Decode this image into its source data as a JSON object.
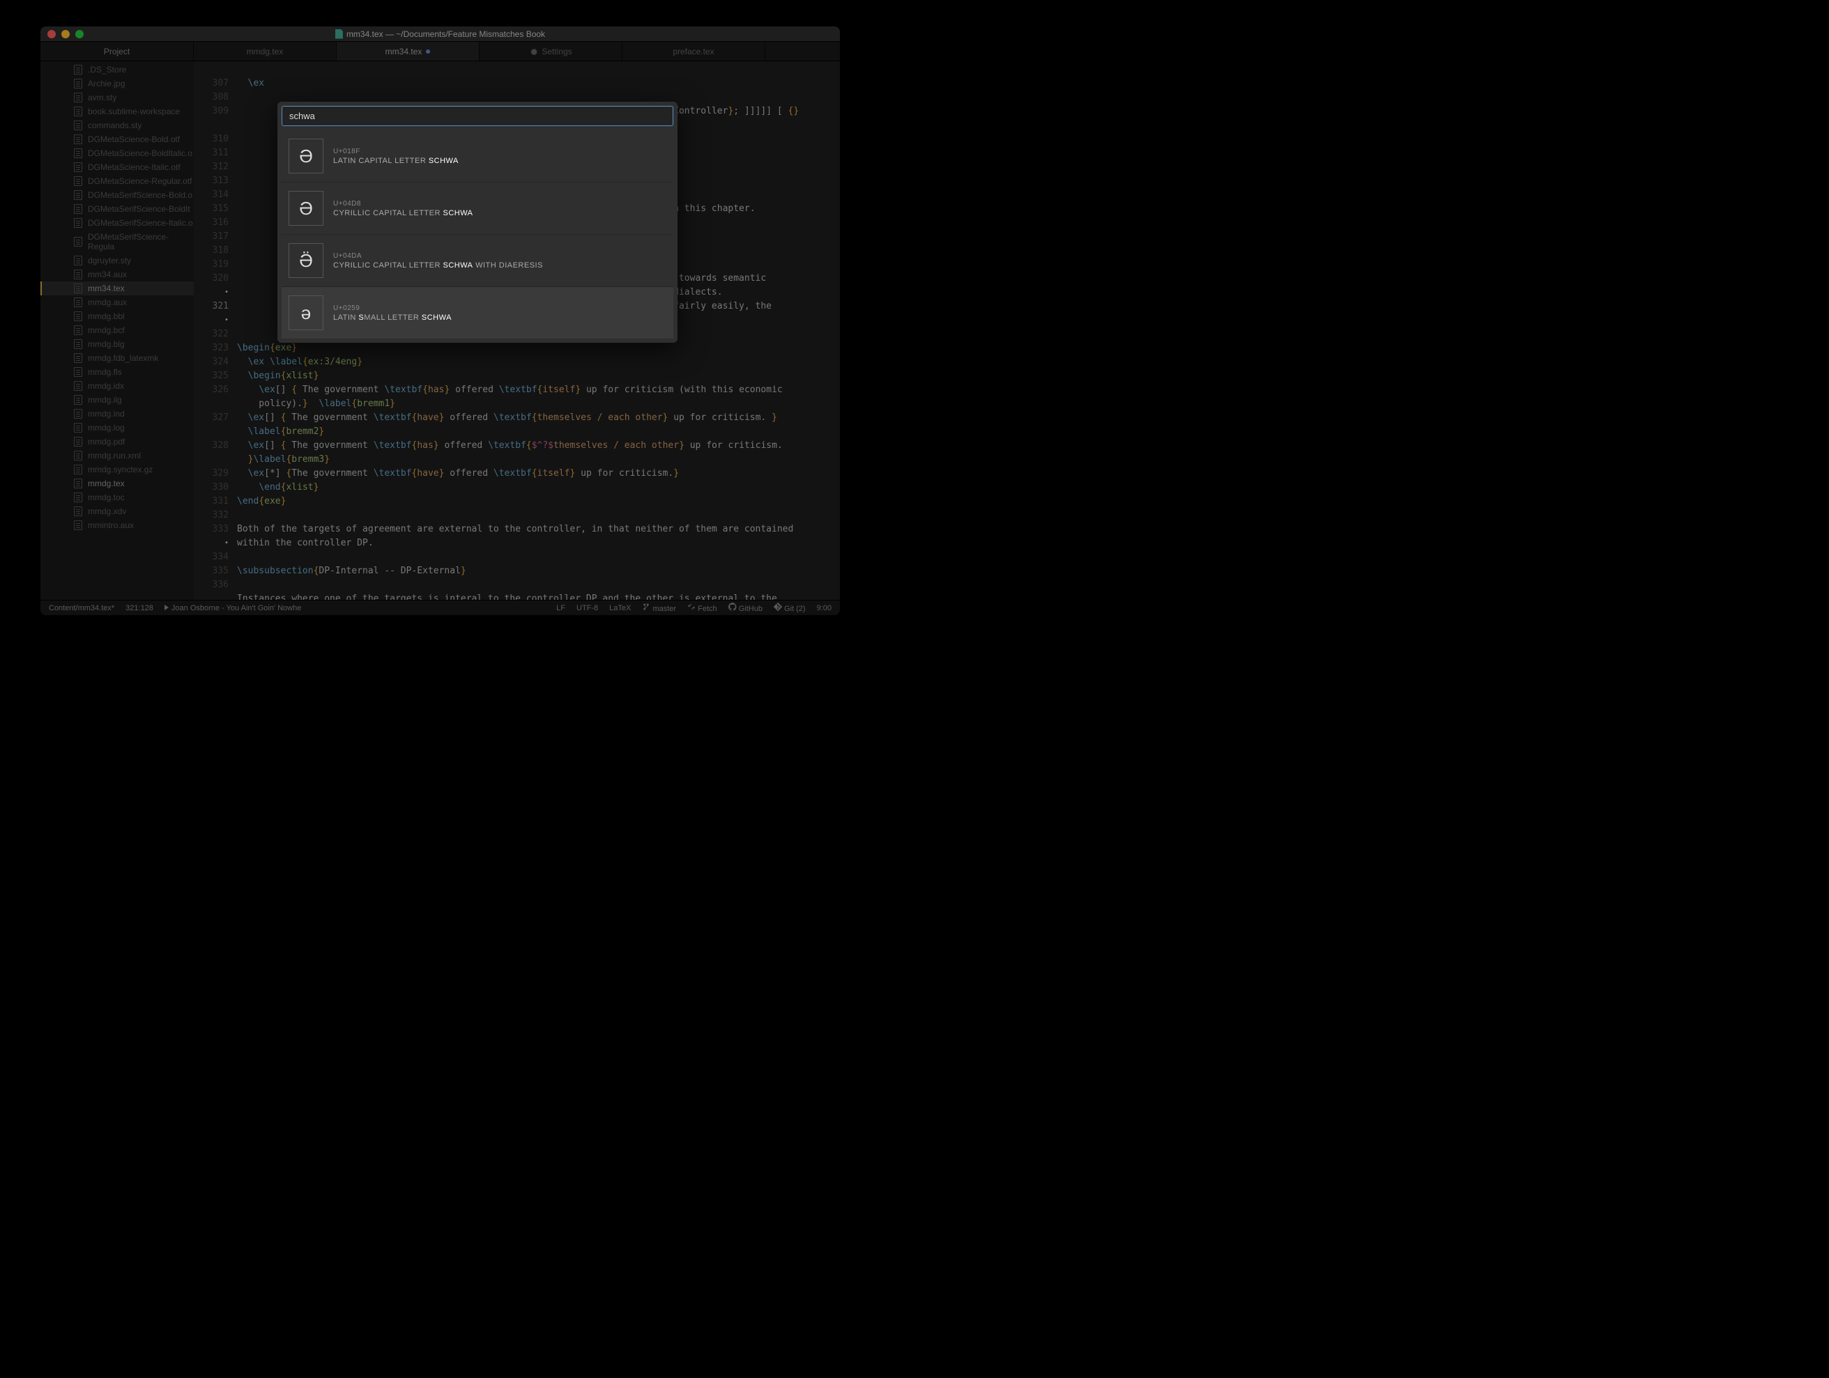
{
  "window": {
    "title": "mm34.tex — ~/Documents/Feature Mismatches Book"
  },
  "tabs": {
    "project": "Project",
    "items": [
      {
        "label": "mmdg.tex",
        "active": false,
        "modified": false
      },
      {
        "label": "mm34.tex",
        "active": true,
        "modified": true
      },
      {
        "label": "Settings",
        "active": false,
        "modified": false,
        "icon": "gear"
      },
      {
        "label": "preface.tex",
        "active": false,
        "modified": false
      }
    ]
  },
  "sidebar": {
    "files": [
      ".DS_Store",
      "Archie.jpg",
      "avm.sty",
      "book.sublime-workspace",
      "commands.sty",
      "DGMetaScience-Bold.otf",
      "DGMetaScience-BoldItalic.o",
      "DGMetaScience-Italic.otf",
      "DGMetaScience-Regular.otf",
      "DGMetaSerifScience-Bold.o",
      "DGMetaSerifScience-BoldIt",
      "DGMetaSerifScience-Italic.o",
      "DGMetaSerifScience-Regula",
      "dgruyter.sty",
      "mm34.aux",
      "mm34.tex",
      "mmdg.aux",
      "mmdg.bbl",
      "mmdg.bcf",
      "mmdg.blg",
      "mmdg.fdb_latexmk",
      "mmdg.fls",
      "mmdg.idx",
      "mmdg.ilg",
      "mmdg.ind",
      "mmdg.log",
      "mmdg.pdf",
      "mmdg.run.xml",
      "mmdg.synctex.gz",
      "mmdg.tex",
      "mmdg.toc",
      "mmdg.xdv",
      "mmintro.aux"
    ],
    "active_index": 15,
    "bold_indices": [
      15,
      29
    ]
  },
  "editor": {
    "lines_meta": [
      {
        "n": "",
        "mod": false
      },
      {
        "n": "307",
        "mod": false
      },
      {
        "n": "308",
        "mod": false
      },
      {
        "n": "309",
        "mod": false
      },
      {
        "n": "",
        "mod": false
      },
      {
        "n": "310",
        "mod": false
      },
      {
        "n": "311",
        "mod": false
      },
      {
        "n": "312",
        "mod": false
      },
      {
        "n": "313",
        "mod": false
      },
      {
        "n": "314",
        "mod": false
      },
      {
        "n": "315",
        "mod": false
      },
      {
        "n": "316",
        "mod": false
      },
      {
        "n": "317",
        "mod": false
      },
      {
        "n": "318",
        "mod": false
      },
      {
        "n": "319",
        "mod": false
      },
      {
        "n": "320",
        "mod": false
      },
      {
        "n": "",
        "mod": true
      },
      {
        "n": "321",
        "mod": false,
        "cur": true
      },
      {
        "n": "",
        "mod": true
      },
      {
        "n": "322",
        "mod": false
      },
      {
        "n": "323",
        "mod": false
      },
      {
        "n": "324",
        "mod": false
      },
      {
        "n": "325",
        "mod": false
      },
      {
        "n": "326",
        "mod": false
      },
      {
        "n": "",
        "mod": false
      },
      {
        "n": "327",
        "mod": false
      },
      {
        "n": "",
        "mod": false
      },
      {
        "n": "328",
        "mod": false
      },
      {
        "n": "",
        "mod": false
      },
      {
        "n": "329",
        "mod": false
      },
      {
        "n": "330",
        "mod": false
      },
      {
        "n": "331",
        "mod": false
      },
      {
        "n": "332",
        "mod": false
      },
      {
        "n": "333",
        "mod": false
      },
      {
        "n": "",
        "mod": true
      },
      {
        "n": "334",
        "mod": false
      },
      {
        "n": "335",
        "mod": false
      },
      {
        "n": "336",
        "mod": false
      },
      {
        "n": "",
        "mod": false
      }
    ],
    "code_frag": {
      "l1": "  \\ex",
      "l10_tail": "\\node(dp){Controller}; ]]]]] [ {}",
      "l15_tail": "scussion in this chapter.",
      "l20a": "dialect is towards semantic",
      "l20b": "l English dialects.",
      "l20c": "ive nouns fairly easily, the",
      "begin_exe": "\\begin{exe}",
      "ex_label": "  \\ex \\label{ex:3/4eng}",
      "begin_xlist": "  \\begin{xlist}",
      "l326a": "    \\ex[] { The government \\textbf{",
      "l326b": "} offered \\textbf{",
      "l326c": "} up for criticism (with this economic",
      "l326d": "    policy).}  \\label{",
      "bremm1": "bremm1",
      "l327a": "  \\ex[] { The government \\textbf{",
      "l327b": "} offered \\textbf{",
      "l327c": "} up for criticism. }",
      "l327d": "  \\label{",
      "bremm2": "bremm2",
      "l328a": "  \\ex[] { The government \\textbf{",
      "l328b": "} offered \\textbf{",
      "l328c": "} up for criticism.",
      "l328d": "  }\\label{",
      "bremm3": "bremm3",
      "l329a": "  \\ex[*] {The government \\textbf{",
      "l329b": "} offered \\textbf{",
      "l329c": "} up for criticism.}",
      "end_xlist": "    \\end{xlist}",
      "end_exe": "\\end{exe}",
      "l333": "Both of the targets of agreement are external to the controller, in that neither of them are contained",
      "l333b": "within the controller DP.",
      "l335": "\\subsubsection{DP-Internal -- DP-External}",
      "l_last": "Instances where one of the targets is interal to the controller DP and the other is external to the",
      "has": "has",
      "have": "have",
      "itself": "itself",
      "themselves_each": "themselves / each other",
      "sp_themselves": "$^?$themselves",
      "each_other": "each other",
      "slash": " / "
    }
  },
  "popup": {
    "query": "schwa",
    "results": [
      {
        "glyph": "Ə",
        "code": "U+018F",
        "name_pre": "LATIN CAPITAL LETTER ",
        "name_hl": "SCHWA",
        "name_post": "",
        "selected": false
      },
      {
        "glyph": "Ә",
        "code": "U+04D8",
        "name_pre": "CYRILLIC CAPITAL LETTER ",
        "name_hl": "SCHWA",
        "name_post": "",
        "selected": false
      },
      {
        "glyph": "Ӛ",
        "code": "U+04DA",
        "name_pre": "CYRILLIC CAPITAL LETTER ",
        "name_hl": "SCHWA",
        "name_post": " WITH DIAERESIS",
        "selected": false
      },
      {
        "glyph": "ə",
        "code": "U+0259",
        "name_pre": "LATIN ",
        "name_hl": "S",
        "name_mid": "MALL LETTER ",
        "name_hl2": "SCHWA",
        "selected": true
      }
    ]
  },
  "status": {
    "path": "Content/mm34.tex*",
    "pos": "321:128",
    "now_playing": "Joan Osborne - You Ain't Goin' Nowhe",
    "encoding_lf": "LF",
    "encoding": "UTF-8",
    "syntax": "LaTeX",
    "branch": "master",
    "fetch": "Fetch",
    "github": "GitHub",
    "git": "Git (2)",
    "time": "9:00"
  }
}
